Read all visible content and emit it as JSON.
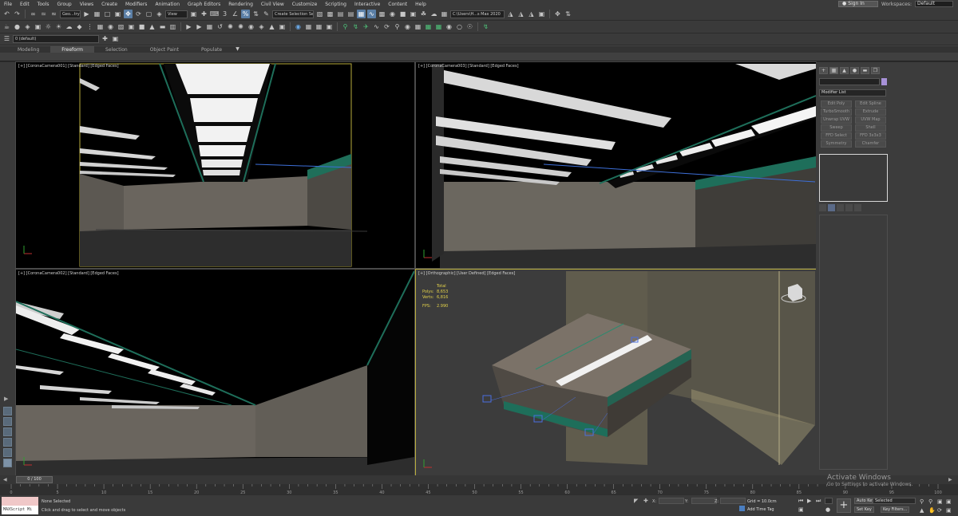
{
  "menu": [
    "File",
    "Edit",
    "Tools",
    "Group",
    "Views",
    "Create",
    "Modifiers",
    "Animation",
    "Graph Editors",
    "Rendering",
    "Civil View",
    "Customize",
    "Scripting",
    "Interactive",
    "Content",
    "Help"
  ],
  "account": {
    "sign_in": "Sign In",
    "workspaces_label": "Workspaces:",
    "workspace_value": "Default"
  },
  "toolbar": {
    "selection_filter": "Geo...try",
    "ref_coord": "View",
    "named_selection": "Create Selection Se",
    "project_path": "C:\\Users\\H...s Max 2020",
    "layer": "0 (default)"
  },
  "ribbon_tabs": [
    "Modeling",
    "Freeform",
    "Selection",
    "Object Paint",
    "Populate"
  ],
  "viewports": {
    "top_left": "[+] [CoronaCamera001] [Standard] [Edged Faces]",
    "top_right": "[+] [CoronaCamera003] [Standard] [Edged Faces]",
    "bottom_left": "[+] [CoronaCamera002] [Standard] [Edged Faces]",
    "bottom_right": "[+] [Orthographic] [User Defined] [Edged Faces]",
    "stats": {
      "header": "Total",
      "polys_label": "Polys:",
      "polys_value": "8,653",
      "verts_label": "Verts:",
      "verts_value": "6,816",
      "fps_label": "FPS:",
      "fps_value": "2.990"
    }
  },
  "command_panel": {
    "modifier_list": "Modifier List",
    "buttons": [
      "Edit Poly",
      "Edit Spline",
      "TurboSmooth",
      "Extrude",
      "Unwrap UVW",
      "UVW Map",
      "Sweep",
      "Shell",
      "FFD Select",
      "FFD 3x3x3",
      "Symmetry",
      "Chamfer"
    ]
  },
  "timeline": {
    "frame_label": "0 / 100",
    "ticks": [
      "0",
      "5",
      "10",
      "15",
      "20",
      "25",
      "30",
      "35",
      "40",
      "45",
      "50",
      "55",
      "60",
      "65",
      "70",
      "75",
      "80",
      "85",
      "90",
      "95",
      "100"
    ]
  },
  "status": {
    "maxscript": "MAXScript Mi",
    "selection": "None Selected",
    "prompt": "Click and drag to select and move objects",
    "x_label": "X:",
    "y_label": "Y:",
    "z_label": "Z:",
    "grid": "Grid = 10.0cm",
    "add_time_tag": "Add Time Tag",
    "auto_key": "Auto Key",
    "set_key": "Set Key",
    "key_mode": "Selected",
    "key_filters": "Key Filters..."
  },
  "activate_windows": {
    "title": "Activate Windows",
    "subtitle": "Go to Settings to activate Windows."
  }
}
